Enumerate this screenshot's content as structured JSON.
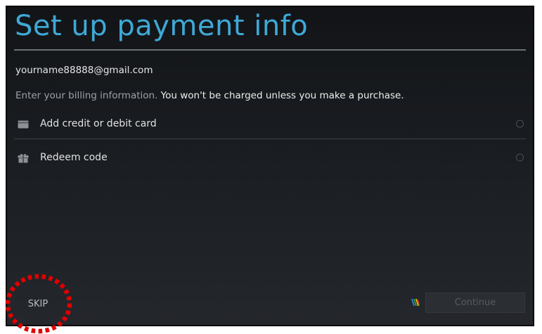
{
  "screen": {
    "title": "Set up payment info",
    "account_email": "yourname88888@gmail.com",
    "billing_intro": "Enter your billing information.",
    "billing_notice": "You won't be charged unless you make a purchase."
  },
  "options": [
    {
      "label": "Add credit or debit card",
      "icon": "credit-card-icon",
      "selected": false
    },
    {
      "label": "Redeem code",
      "icon": "gift-icon",
      "selected": false
    }
  ],
  "footer": {
    "skip_label": "SKIP",
    "continue_label": "Continue",
    "continue_enabled": false,
    "wallet_icon": "google-wallet-icon"
  },
  "colors": {
    "title": "#3fa9d6",
    "highlight_circle": "#e10000"
  }
}
